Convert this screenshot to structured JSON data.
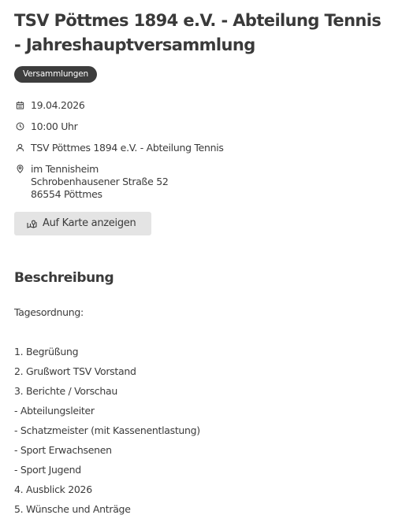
{
  "event": {
    "title": "TSV Pöttmes 1894 e.V. - Abteilung Tennis - Jahreshauptversammlung",
    "category_badge": "Versammlungen",
    "date": "19.04.2026",
    "time": "10:00 Uhr",
    "organizer": "TSV Pöttmes 1894 e.V. - Abteilung Tennis",
    "location": {
      "venue": "im Tennisheim",
      "street": "Schrobenhausener Straße 52",
      "city": "86554 Pöttmes"
    },
    "map_button_label": "Auf Karte anzeigen"
  },
  "description": {
    "heading": "Beschreibung",
    "intro": "Tagesordnung:",
    "agenda": [
      "1. Begrüßung",
      "2. Grußwort TSV Vorstand",
      "3. Berichte / Vorschau",
      "- Abteilungsleiter",
      "- Schatzmeister (mit Kassenentlastung)",
      "- Sport Erwachsenen",
      "- Sport Jugend",
      "4. Ausblick 2026",
      "5. Wünsche und Anträge"
    ]
  },
  "icons": {
    "date": "calendar-icon",
    "time": "clock-icon",
    "organizer": "user-icon",
    "location": "map-pin-icon",
    "map_button": "map-icon"
  },
  "colors": {
    "text": "#3b3b3b",
    "badge_background": "#3d3d3d",
    "badge_text": "#ffffff",
    "button_background": "#e4e4e4"
  }
}
